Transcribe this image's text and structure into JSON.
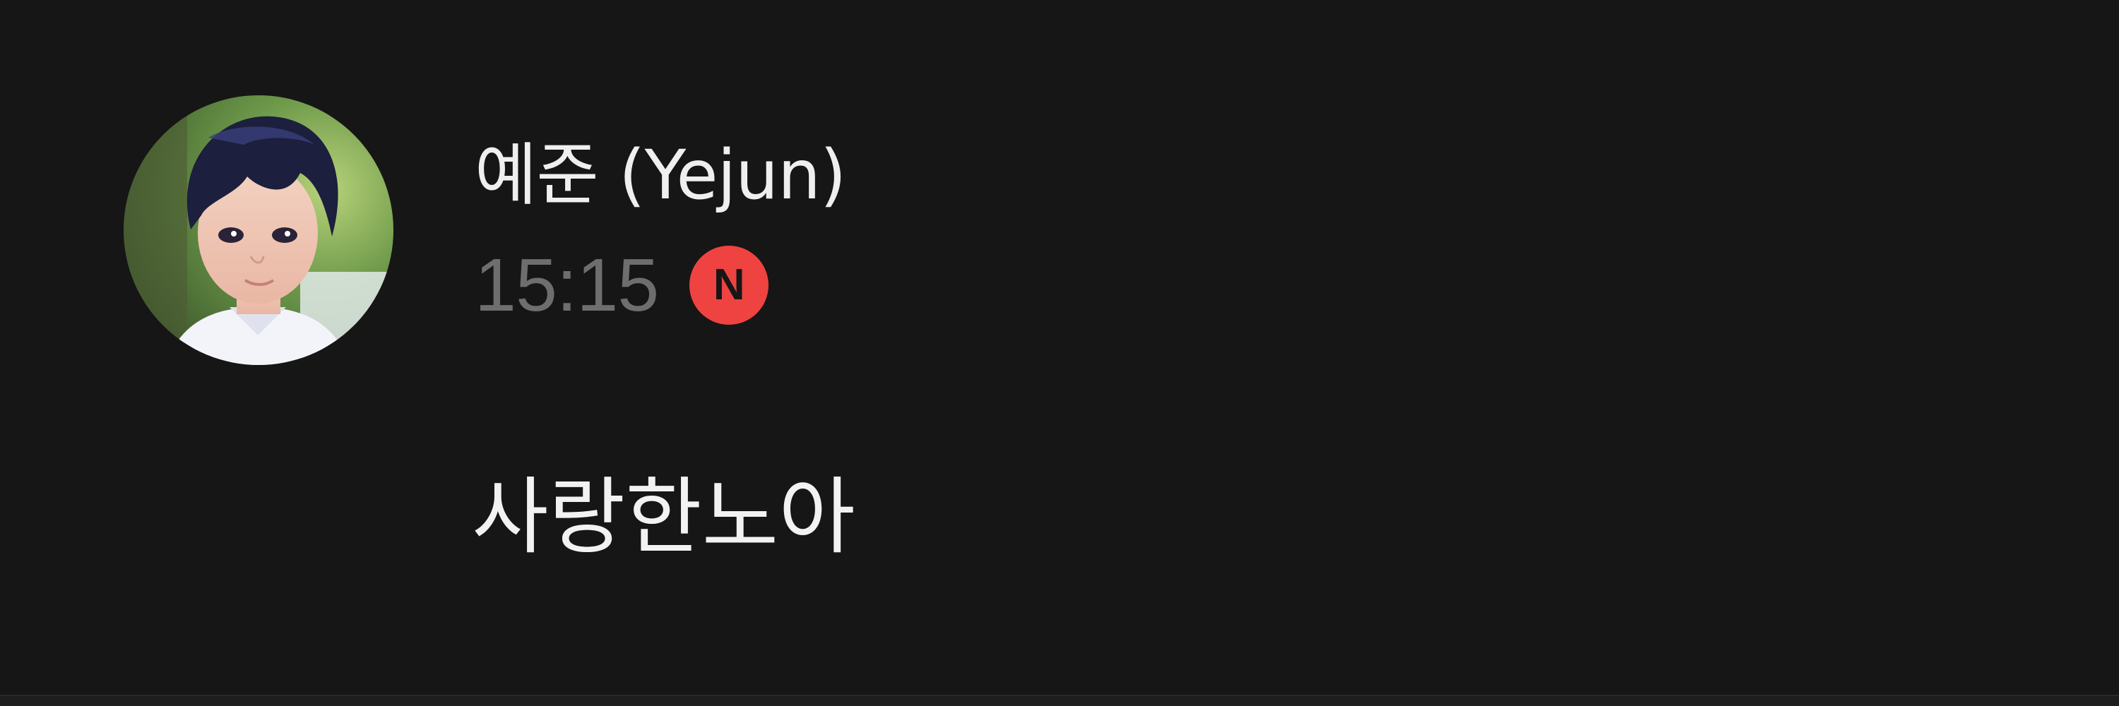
{
  "message": {
    "sender_name": "예준 (Yejun)",
    "timestamp": "15:15",
    "new_badge": "N",
    "text": "사랑한노아",
    "avatar": "profile-avatar-illustrated-portrait"
  },
  "colors": {
    "background": "#161616",
    "name_text": "#efefef",
    "timestamp_text": "#6e6e6e",
    "badge_background": "#ef4341",
    "message_text": "#f2f2f2"
  }
}
